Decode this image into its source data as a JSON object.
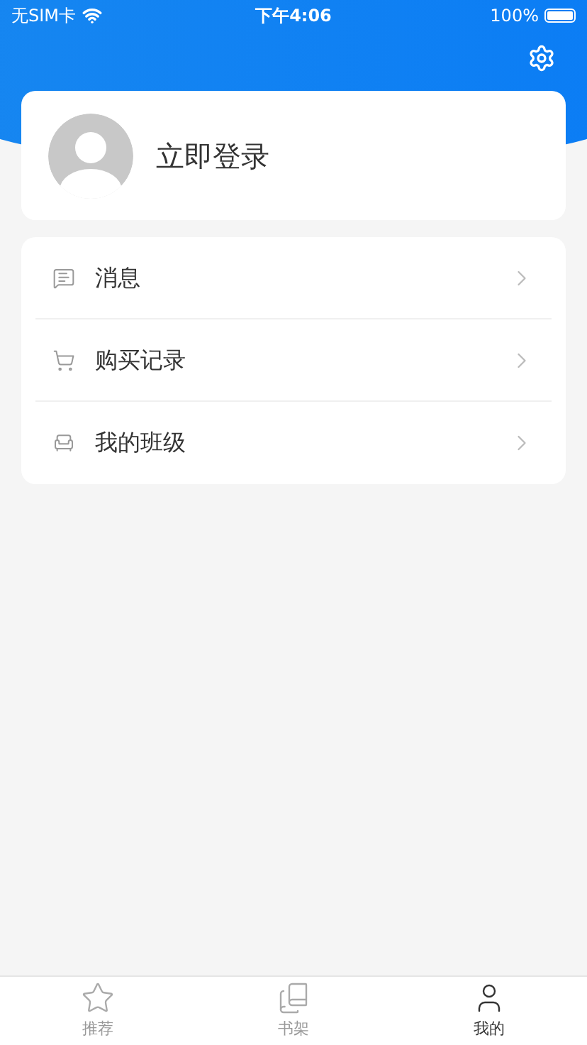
{
  "status_bar": {
    "carrier": "无SIM卡",
    "time": "下午4:06",
    "battery": "100%"
  },
  "profile": {
    "login_label": "立即登录"
  },
  "menu": [
    {
      "kind": "message",
      "label": "消息"
    },
    {
      "kind": "cart",
      "label": "购买记录"
    },
    {
      "kind": "class",
      "label": "我的班级"
    }
  ],
  "tab_bar": [
    {
      "kind": "star",
      "label": "推荐",
      "selected": false
    },
    {
      "kind": "shelf",
      "label": "书架",
      "selected": false
    },
    {
      "kind": "user",
      "label": "我的",
      "selected": true
    }
  ]
}
